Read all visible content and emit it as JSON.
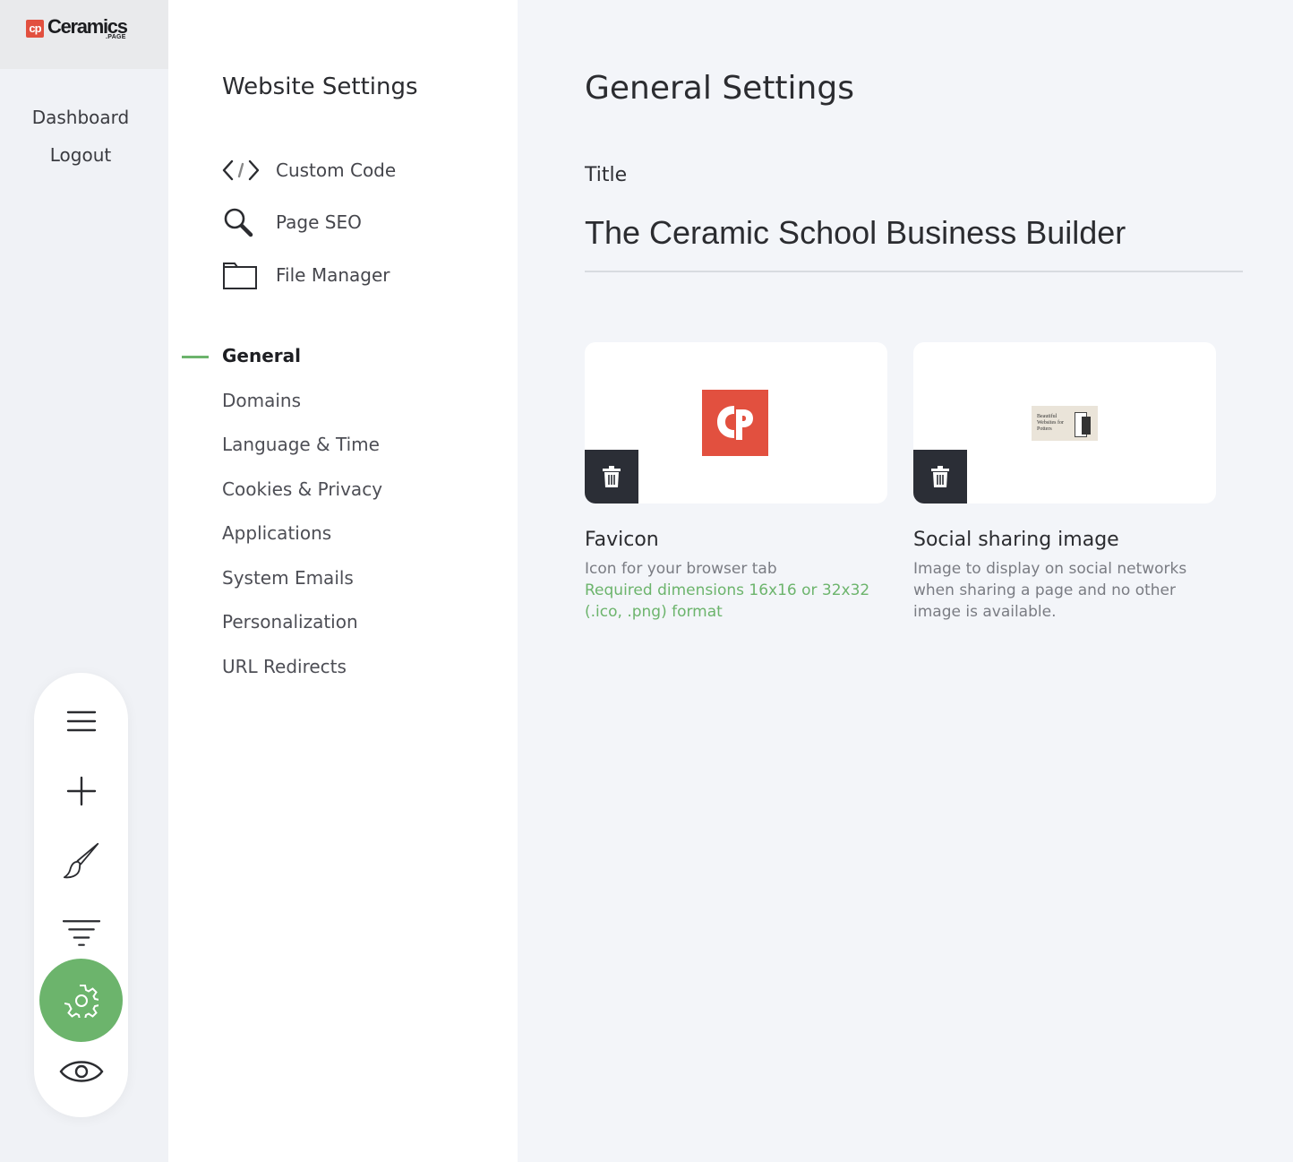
{
  "brand": {
    "logo_mark": "cp",
    "logo_word": "Ceramics",
    "logo_sub": ".PAGE"
  },
  "rail": {
    "links": [
      "Dashboard",
      "Logout"
    ],
    "dock_icons": [
      "menu-icon",
      "plus-icon",
      "brush-icon",
      "filter-icon",
      "gear-icon",
      "eye-icon"
    ],
    "active": "gear-icon"
  },
  "panel": {
    "title": "Website Settings",
    "tools": [
      {
        "label": "Custom Code",
        "icon": "code-icon"
      },
      {
        "label": "Page SEO",
        "icon": "search-icon"
      },
      {
        "label": "File Manager",
        "icon": "folder-icon"
      }
    ],
    "nav": [
      "General",
      "Domains",
      "Language & Time",
      "Cookies & Privacy",
      "Applications",
      "System Emails",
      "Personalization",
      "URL Redirects"
    ],
    "active_nav": "General"
  },
  "main": {
    "title": "General Settings",
    "field_label": "Title",
    "title_value": "The Ceramic School Business Builder",
    "favicon": {
      "title": "Favicon",
      "desc": "Icon for your browser tab",
      "req": "Required dimensions 16x16 or 32x32 (.ico, .png) format"
    },
    "social": {
      "title": "Social sharing image",
      "desc": "Image to display on social networks when sharing a page and no other image is available.",
      "thumb_text": "Beautiful Websites for Potters"
    }
  },
  "colors": {
    "accent": "#6cb46c",
    "brand_red": "#e2503f",
    "dark": "#2b2e36"
  }
}
